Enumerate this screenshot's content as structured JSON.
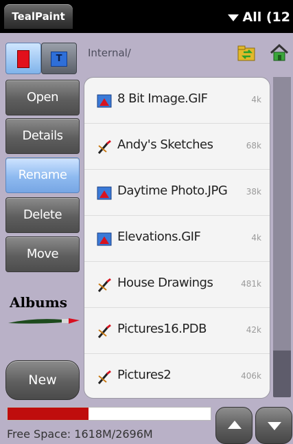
{
  "topbar": {
    "app_tab": "TealPaint",
    "filter_label": "All (12"
  },
  "sidebar": {
    "buttons": [
      "Open",
      "Details",
      "Rename",
      "Delete",
      "Move"
    ],
    "active_button": "Rename",
    "albums_label": "Albums",
    "new_label": "New"
  },
  "path": {
    "text": "Internal/"
  },
  "files": [
    {
      "name": "8 Bit Image.GIF",
      "size": "4k",
      "icon": "image-icon"
    },
    {
      "name": "Andy's Sketches",
      "size": "68k",
      "icon": "brush-icon"
    },
    {
      "name": "Daytime Photo.JPG",
      "size": "38k",
      "icon": "image-icon"
    },
    {
      "name": "Elevations.GIF",
      "size": "4k",
      "icon": "image-icon"
    },
    {
      "name": "House Drawings",
      "size": "481k",
      "icon": "brush-icon"
    },
    {
      "name": "Pictures16.PDB",
      "size": "42k",
      "icon": "brush-icon"
    },
    {
      "name": "Pictures2",
      "size": "406k",
      "icon": "brush-icon"
    }
  ],
  "footer": {
    "free_space": "Free Space: 1618M/2696M",
    "used_fraction": 0.4
  },
  "colors": {
    "background": "#b9b1c7",
    "active_button": "#8ebaf0",
    "free_bar": "#bf0d0d"
  }
}
